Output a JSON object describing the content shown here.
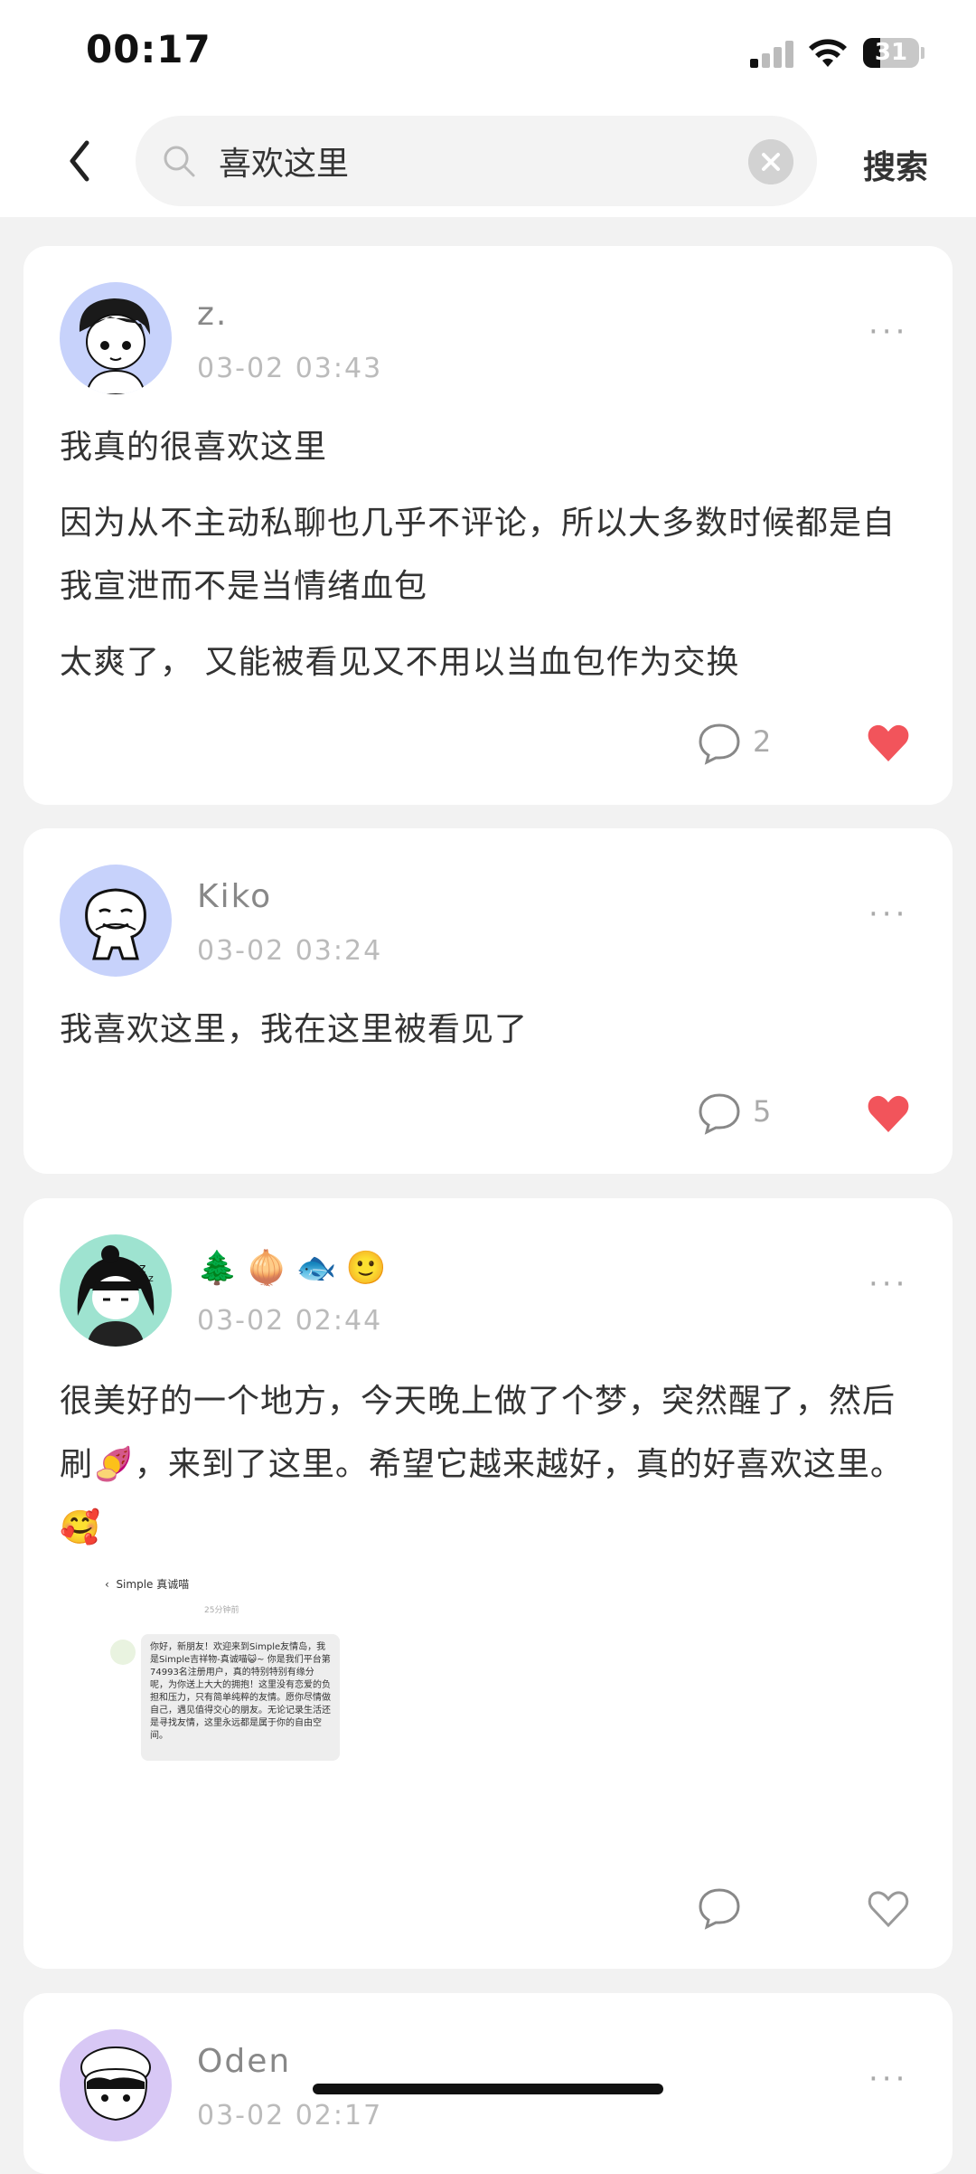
{
  "status_bar": {
    "time": "00:17",
    "battery": "31"
  },
  "search": {
    "query": "喜欢这里",
    "button_label": "搜索"
  },
  "posts": [
    {
      "username": "z.",
      "timestamp": "03-02 03:43",
      "paragraphs": [
        "我真的很喜欢这里",
        "因为从不主动私聊也几乎不评论，所以大多数时候都是自我宣泄而不是当情绪血包",
        "太爽了， 又能被看见又不用以当血包作为交换"
      ],
      "comment_count": "2",
      "liked": true
    },
    {
      "username": "Kiko",
      "timestamp": "03-02 03:24",
      "paragraphs": [
        "我喜欢这里，我在这里被看见了"
      ],
      "comment_count": "5",
      "liked": true
    },
    {
      "username": "🌲🧅🐟🙂",
      "timestamp": "03-02 02:44",
      "paragraphs": [
        "很美好的一个地方，今天晚上做了个梦，突然醒了，然后刷🍠，来到了这里。希望它越来越好，真的好喜欢这里。🥰"
      ],
      "image": {
        "title": "Simple 真诚喵",
        "time": "25分钟前",
        "message": "你好，新朋友！欢迎来到Simple友情岛，我是Simple吉祥物-真诚喵😺~ 你是我们平台第74993名注册用户，真的特别特别有缘分呢，为你送上大大的拥抱！这里没有恋爱的负担和压力，只有简单纯粹的友情。愿你尽情做自己，遇见值得交心的朋友。无论记录生活还是寻找友情，这里永远都是属于你的自由空间。"
      },
      "comment_count": "",
      "liked": false
    },
    {
      "username": "Oden",
      "timestamp": "03-02 02:17"
    }
  ],
  "colors": {
    "like_red": "#f2545b",
    "avatar_blue": "#c7d2fb",
    "avatar_teal": "#9ee3d0",
    "avatar_purple": "#d8c8f5"
  }
}
